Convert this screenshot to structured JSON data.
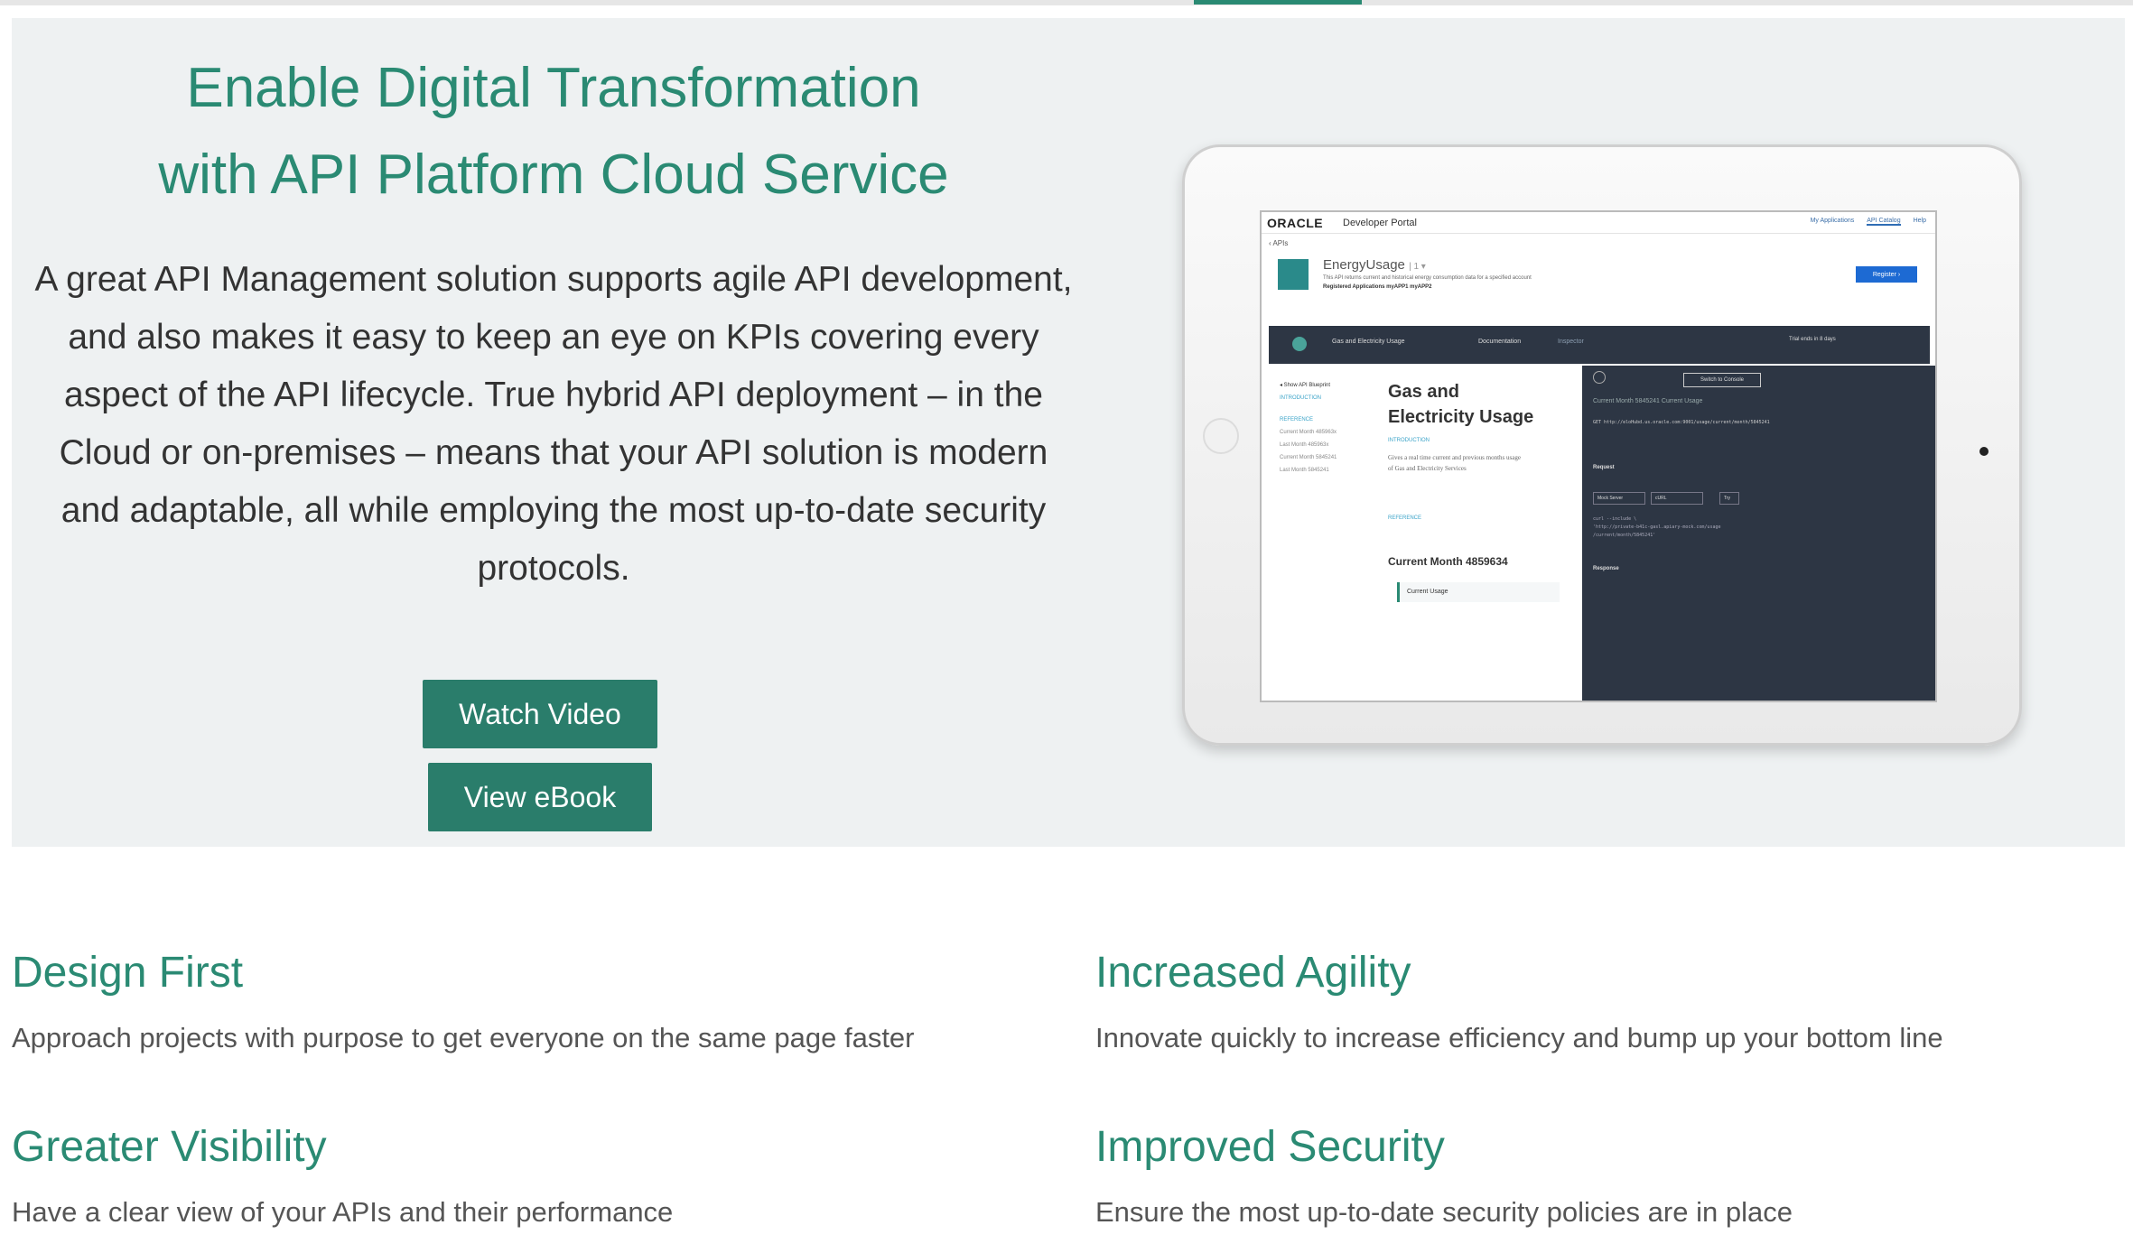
{
  "hero": {
    "title_line1": "Enable Digital Transformation",
    "title_line2": "with API Platform Cloud Service",
    "description": "A great API Management solution supports agile API development, and also makes it easy to keep an eye on KPIs covering every aspect of the API lifecycle. True hybrid API deployment – in the Cloud or on-premises – means that your API solution is modern and adaptable, all while employing the most up-to-date security protocols.",
    "watch_video_label": "Watch Video",
    "view_ebook_label": "View eBook"
  },
  "screen": {
    "logo": "ORACLE",
    "portal": "Developer Portal",
    "nav": [
      "My Applications",
      "API Catalog",
      "Help"
    ],
    "back": "‹  APIs",
    "api_name": "EnergyUsage",
    "api_version": "| 1 ▾",
    "api_desc": "This API returns current and historical energy consumption data for a specified account",
    "api_reg": "Registered Applications   myAPP1   myAPP2",
    "register": "Register ›",
    "bar_api": "Gas and Electricity Usage",
    "bar_doc": "Documentation",
    "bar_inspector": "Inspector",
    "bar_trial": "Trial ends in 8 days",
    "side_blueprint": "◂ Show API Blueprint",
    "side_intro": "INTRODUCTION",
    "side_ref": "REFERENCE",
    "side_items": [
      "Current Month 485963x",
      "Last Month 485963x",
      "Current Month 5845241",
      "Last Month 5845241"
    ],
    "main_title": "Gas and Electricity Usage",
    "intro_label": "INTRODUCTION",
    "intro_text": "Gives a real time current and previous months usage of Gas and Electricity Services",
    "ref_label": "REFERENCE",
    "current_month": "Current Month 4859634",
    "current_usage": "Current Usage",
    "switch_console": "Switch to Console",
    "dark_tabs": "Current Month 5845241      Current Usage",
    "dark_code": "GET  http://eloHubd.us.oracle.com:9001/usage/current/month/5845241",
    "request": "Request",
    "mock_server": "Mock Server",
    "curl": "cURL",
    "try": "Try",
    "curl_code_1": "curl --include \\",
    "curl_code_2": "'http://private-b41c-gasl.apiary-mock.com/usage",
    "curl_code_3": "/current/month/5845241'",
    "response": "Response"
  },
  "features": [
    {
      "title": "Design First",
      "text": "Approach projects with purpose to get everyone on the same page faster"
    },
    {
      "title": "Increased Agility",
      "text": "Innovate quickly to increase efficiency and bump up your bottom line"
    },
    {
      "title": "Greater Visibility",
      "text": "Have a clear view of your APIs and their performance"
    },
    {
      "title": "Improved Security",
      "text": "Ensure the most up-to-date security policies are in place"
    }
  ],
  "colors": {
    "accent": "#2a8a73",
    "button": "#2a7d6b",
    "hero_bg": "#eef1f2"
  }
}
